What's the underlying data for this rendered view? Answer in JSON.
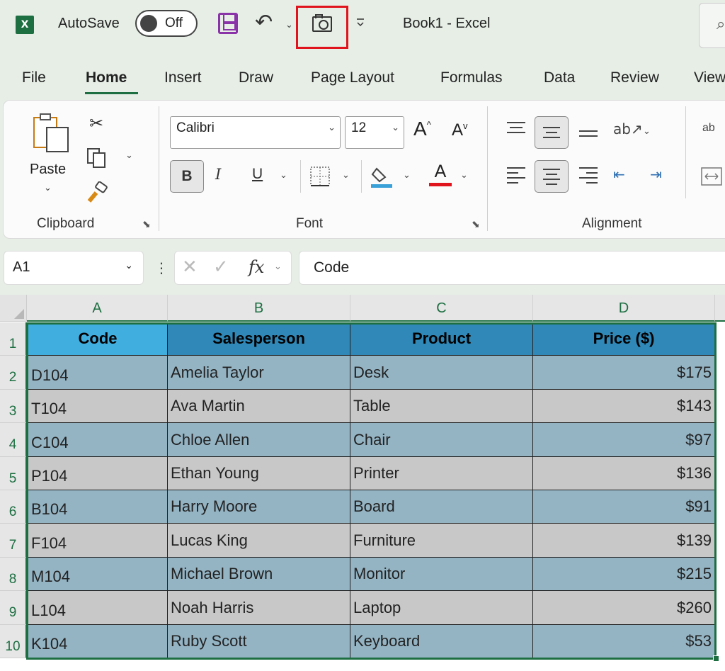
{
  "titlebar": {
    "app_icon_letter": "X",
    "autosave_label": "AutoSave",
    "autosave_state": "Off",
    "document_title": "Book1  -  Excel",
    "icons": [
      "excel-logo-icon",
      "save-icon",
      "undo-icon",
      "camera-icon",
      "customize-qat-icon",
      "search-icon"
    ]
  },
  "tabs": [
    "File",
    "Home",
    "Insert",
    "Draw",
    "Page Layout",
    "Formulas",
    "Data",
    "Review",
    "View"
  ],
  "active_tab": "Home",
  "ribbon": {
    "clipboard": {
      "label": "Clipboard",
      "paste_label": "Paste"
    },
    "font": {
      "label": "Font",
      "font_name": "Calibri",
      "font_size": "12",
      "bold": "B",
      "italic": "I",
      "underline": "U",
      "font_color_glyph": "A",
      "grow_glyph": "A",
      "shrink_glyph": "A"
    },
    "alignment": {
      "label": "Alignment"
    },
    "wrap_glyph": "ab"
  },
  "formula_bar": {
    "name_box": "A1",
    "fx_label": "fx",
    "content": "Code"
  },
  "sheet": {
    "columns": [
      "A",
      "B",
      "C",
      "D"
    ],
    "row_numbers": [
      "1",
      "2",
      "3",
      "4",
      "5",
      "6",
      "7",
      "8",
      "9",
      "10"
    ],
    "headers": [
      "Code",
      "Salesperson",
      "Product",
      "Price ($)"
    ],
    "rows": [
      [
        "D104",
        "Amelia Taylor",
        "Desk",
        "$175"
      ],
      [
        "T104",
        "Ava Martin",
        "Table",
        "$143"
      ],
      [
        "C104",
        "Chloe Allen",
        "Chair",
        "$97"
      ],
      [
        "P104",
        "Ethan Young",
        "Printer",
        "$136"
      ],
      [
        "B104",
        "Harry Moore",
        "Board",
        "$91"
      ],
      [
        "F104",
        "Lucas King",
        "Furniture",
        "$139"
      ],
      [
        "M104",
        "Michael Brown",
        "Monitor",
        "$215"
      ],
      [
        "L104",
        "Noah Harris",
        "Laptop",
        "$260"
      ],
      [
        "K104",
        "Ruby Scott",
        "Keyboard",
        "$53"
      ]
    ]
  },
  "colors": {
    "header_blue": "#2f88b7",
    "header_a1": "#41aee0",
    "row_blue": "#94b4c4",
    "row_gray": "#c8c8c8",
    "excel_green": "#1d6f42",
    "highlight_red": "#e0141c"
  }
}
